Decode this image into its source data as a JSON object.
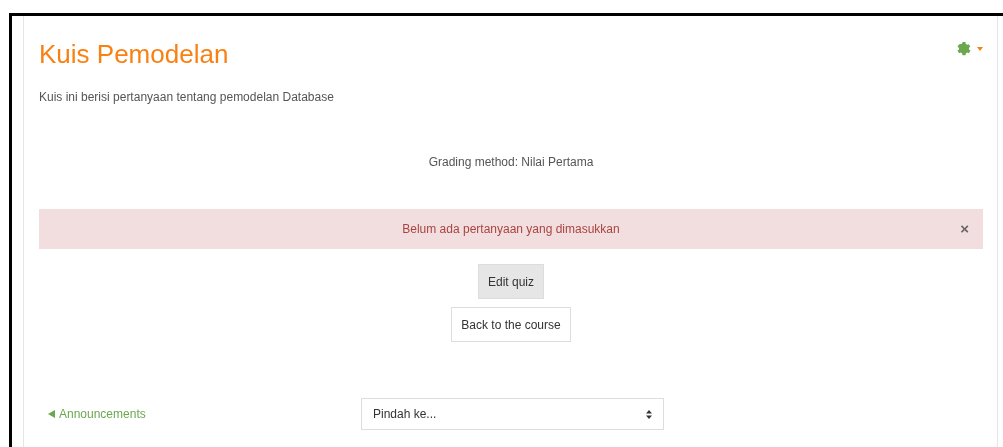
{
  "title": "Kuis Pemodelan",
  "description": "Kuis ini berisi pertanyaan tentang pemodelan Database",
  "grading": "Grading method: Nilai Pertama",
  "alert": {
    "message": "Belum ada pertanyaan yang dimasukkan",
    "close": "×"
  },
  "buttons": [
    {
      "label": "Edit quiz",
      "selected": true
    },
    {
      "label": "Back to the course",
      "selected": false
    }
  ],
  "prev_link": "Announcements",
  "jump": {
    "value": "Pindah ke..."
  }
}
